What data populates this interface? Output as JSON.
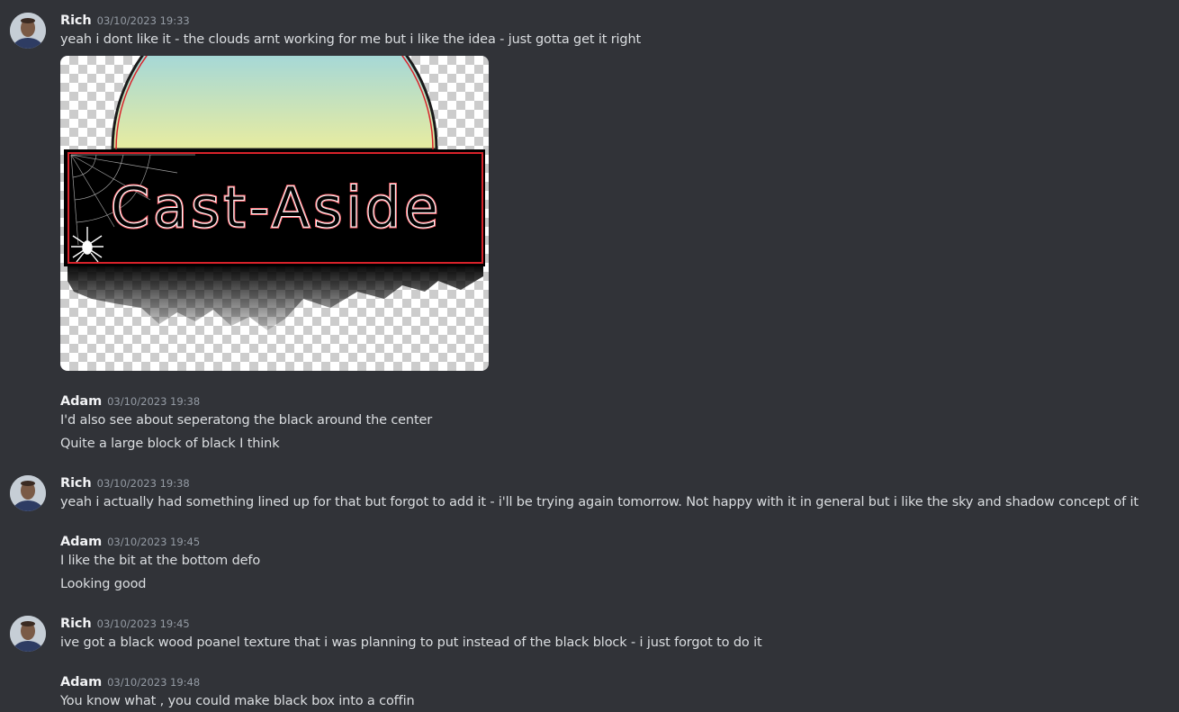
{
  "messages": [
    {
      "author": "Rich",
      "timestamp": "03/10/2023 19:33",
      "lines": [
        "yeah i dont like it - the clouds arnt working for me but i like the idea - just gotta get it right"
      ],
      "attachment": {
        "logo_text": "Cast-Aside"
      }
    },
    {
      "author": "Adam",
      "timestamp": "03/10/2023 19:38",
      "lines": [
        "I'd also see about seperatong the black around the center",
        "Quite a large block of black I think"
      ]
    },
    {
      "author": "Rich",
      "timestamp": "03/10/2023 19:38",
      "lines": [
        "yeah i actually had something lined up for that but forgot to add it - i'll be trying again tomorrow. Not happy with it in general but i like the sky and shadow concept of it"
      ]
    },
    {
      "author": "Adam",
      "timestamp": "03/10/2023 19:45",
      "lines": [
        "I like the bit at the bottom defo",
        "Looking good"
      ]
    },
    {
      "author": "Rich",
      "timestamp": "03/10/2023 19:45",
      "lines": [
        "ive got a black wood poanel texture that i was planning to put instead of the black block - i just forgot to do it"
      ]
    },
    {
      "author": "Adam",
      "timestamp": "03/10/2023 19:48",
      "lines": [
        "You know what , you could make black box into a coffin"
      ]
    }
  ],
  "colors": {
    "background": "#313338",
    "author": "#f2f3f5",
    "timestamp": "#949ba4",
    "text": "#dbdee1",
    "logo_red": "#e0202a"
  }
}
